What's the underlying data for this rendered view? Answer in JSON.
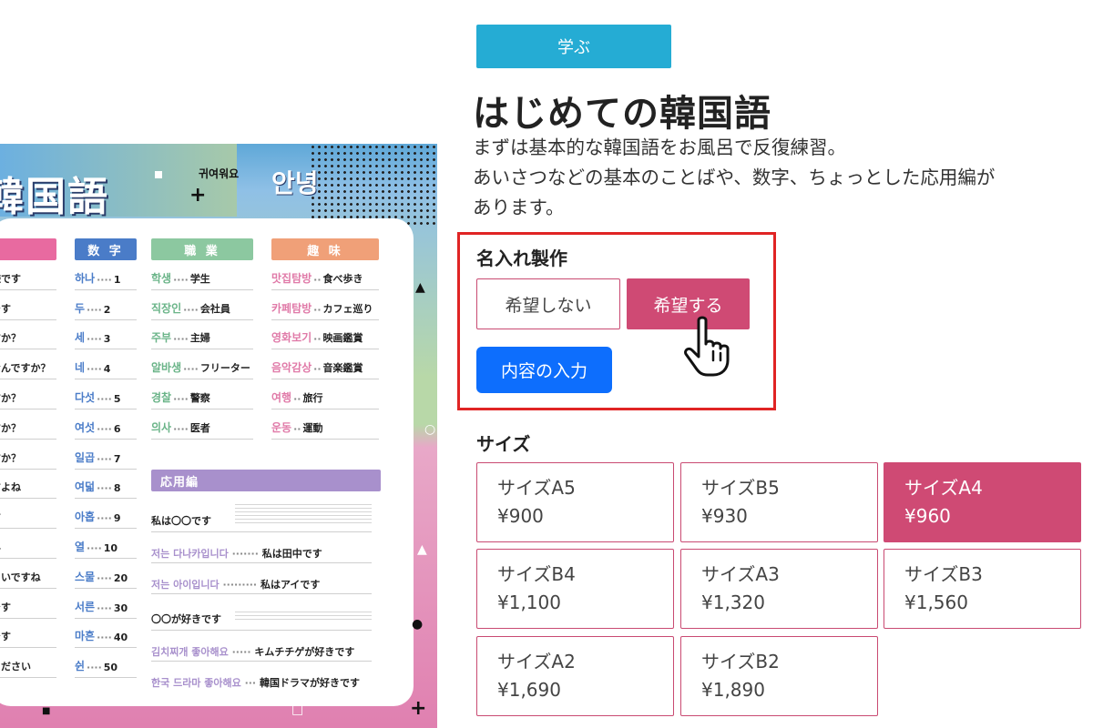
{
  "poster": {
    "title": "韓国語",
    "sticker_small": "귀여워요",
    "sticker_large": "안녕",
    "headers": {
      "numbers": "数 字",
      "jobs": "職 業",
      "hobbies": "趣 味",
      "applied": "応用編"
    },
    "greetings": [
      "様です",
      "です",
      "すか？",
      "なんですか？",
      "すか？",
      "すか？",
      "すか？",
      "すよね",
      "す",
      "ん",
      "ろいですね",
      "です",
      "です",
      "ください"
    ],
    "numbers": [
      {
        "ko": "하나",
        "n": "1"
      },
      {
        "ko": "두",
        "n": "2"
      },
      {
        "ko": "세",
        "n": "3"
      },
      {
        "ko": "네",
        "n": "4"
      },
      {
        "ko": "다섯",
        "n": "5"
      },
      {
        "ko": "여섯",
        "n": "6"
      },
      {
        "ko": "일곱",
        "n": "7"
      },
      {
        "ko": "여덟",
        "n": "8"
      },
      {
        "ko": "아홉",
        "n": "9"
      },
      {
        "ko": "열",
        "n": "10"
      },
      {
        "ko": "스물",
        "n": "20"
      },
      {
        "ko": "서른",
        "n": "30"
      },
      {
        "ko": "마흔",
        "n": "40"
      },
      {
        "ko": "쉰",
        "n": "50"
      }
    ],
    "jobs": [
      {
        "ko": "학생",
        "jp": "学生"
      },
      {
        "ko": "직장인",
        "jp": "会社員"
      },
      {
        "ko": "주부",
        "jp": "主婦"
      },
      {
        "ko": "알바생",
        "jp": "フリーター"
      },
      {
        "ko": "경찰",
        "jp": "警察"
      },
      {
        "ko": "의사",
        "jp": "医者"
      }
    ],
    "hobbies": [
      {
        "ko": "맛집탐방",
        "jp": "食べ歩き"
      },
      {
        "ko": "카페탐방",
        "jp": "カフェ巡り"
      },
      {
        "ko": "영화보기",
        "jp": "映画鑑賞"
      },
      {
        "ko": "음악감상",
        "jp": "音楽鑑賞"
      },
      {
        "ko": "여행",
        "jp": "旅行"
      },
      {
        "ko": "운동",
        "jp": "運動"
      }
    ],
    "applied": {
      "heading1": "私は〇〇です",
      "ex1": {
        "ko": "저는 다나카입니다",
        "jp": "私は田中です"
      },
      "ex2": {
        "ko": "저는 아이입니다",
        "jp": "私はアイです"
      },
      "heading2": "〇〇が好きです",
      "ex3": {
        "ko": "김치찌개 좋아해요",
        "jp": "キムチチゲが好きです"
      },
      "ex4": {
        "ko": "한국 드라마 좋아해요",
        "jp": "韓国ドラマが好きです"
      }
    }
  },
  "product": {
    "category_tag": "学ぶ",
    "title": "はじめての韓国語",
    "description": [
      "まずは基本的な韓国語をお風呂で反復練習。",
      "あいさつなどの基本のことばや、数字、ちょっとした応用編が",
      "あります。"
    ],
    "naming": {
      "label": "名入れ製作",
      "option_no": "希望しない",
      "option_yes": "希望する",
      "selected": "希望する",
      "input_button": "内容の入力"
    },
    "size": {
      "label": "サイズ",
      "selected": "サイズA4",
      "options": [
        {
          "name": "サイズA5",
          "price": "¥900"
        },
        {
          "name": "サイズB5",
          "price": "¥930"
        },
        {
          "name": "サイズA4",
          "price": "¥960"
        },
        {
          "name": "サイズB4",
          "price": "¥1,100"
        },
        {
          "name": "サイズA3",
          "price": "¥1,320"
        },
        {
          "name": "サイズB3",
          "price": "¥1,560"
        },
        {
          "name": "サイズA2",
          "price": "¥1,690"
        },
        {
          "name": "サイズB2",
          "price": "¥1,890"
        }
      ]
    },
    "colors": {
      "accent_pink": "#cf4a74",
      "tag_blue": "#25acd4",
      "input_blue": "#0d6efd",
      "highlight_red": "#e02424"
    }
  }
}
